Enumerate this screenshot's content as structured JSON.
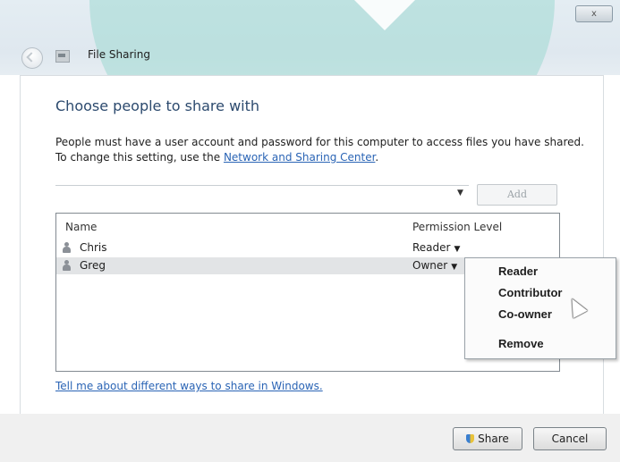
{
  "window": {
    "title": "File Sharing",
    "close_label": "x"
  },
  "main": {
    "heading": "Choose people to share with",
    "description_before": "People must have a user account and password for this computer to access files you have shared.  To change this setting, use the ",
    "description_link": "Network and Sharing Center",
    "description_after": ".",
    "add_button": "Add"
  },
  "list": {
    "headers": {
      "name": "Name",
      "permission": "Permission Level"
    },
    "rows": [
      {
        "name": "Chris",
        "permission": "Reader"
      },
      {
        "name": "Greg",
        "permission": "Owner"
      }
    ]
  },
  "context_menu": {
    "items": [
      "Reader",
      "Contributor",
      "Co-owner",
      "Remove"
    ]
  },
  "footer": {
    "help_link": "Tell me about different ways to share in Windows.",
    "share_button": "Share",
    "cancel_button": "Cancel"
  },
  "icons": {
    "arrow": "▼"
  }
}
